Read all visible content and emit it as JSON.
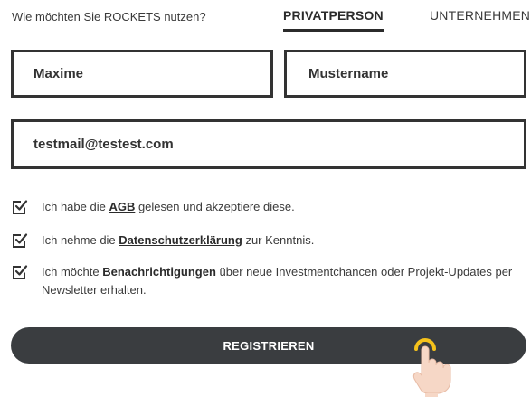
{
  "header": {
    "question": "Wie möchten Sie ROCKETS nutzen?",
    "tabs": [
      {
        "label": "PRIVATPERSON",
        "active": true
      },
      {
        "label": "UNTERNEHMEN",
        "active": false
      }
    ]
  },
  "form": {
    "first_name": "Maxime",
    "last_name": "Mustername",
    "email": "testmail@testest.com"
  },
  "consents": {
    "agb": {
      "before": "Ich habe die ",
      "link": "AGB",
      "after": " gelesen und akzeptiere diese."
    },
    "privacy": {
      "before": "Ich nehme die ",
      "link": "Datenschutzerklärung",
      "after": " zur Kenntnis."
    },
    "newsletter": {
      "before": "Ich möchte ",
      "bold": "Benachrichtigungen",
      "after": " über neue Investmentchancen oder Projekt-Updates per Newsletter erhalten."
    }
  },
  "submit_label": "REGISTRIEREN",
  "colors": {
    "button": "#3a3d40",
    "tap_indicator": "#f5c21b",
    "text": "#2f2f2f"
  },
  "icons": {
    "checkbox": "checkbox-checked-icon",
    "cursor": "tap-hand-icon"
  }
}
